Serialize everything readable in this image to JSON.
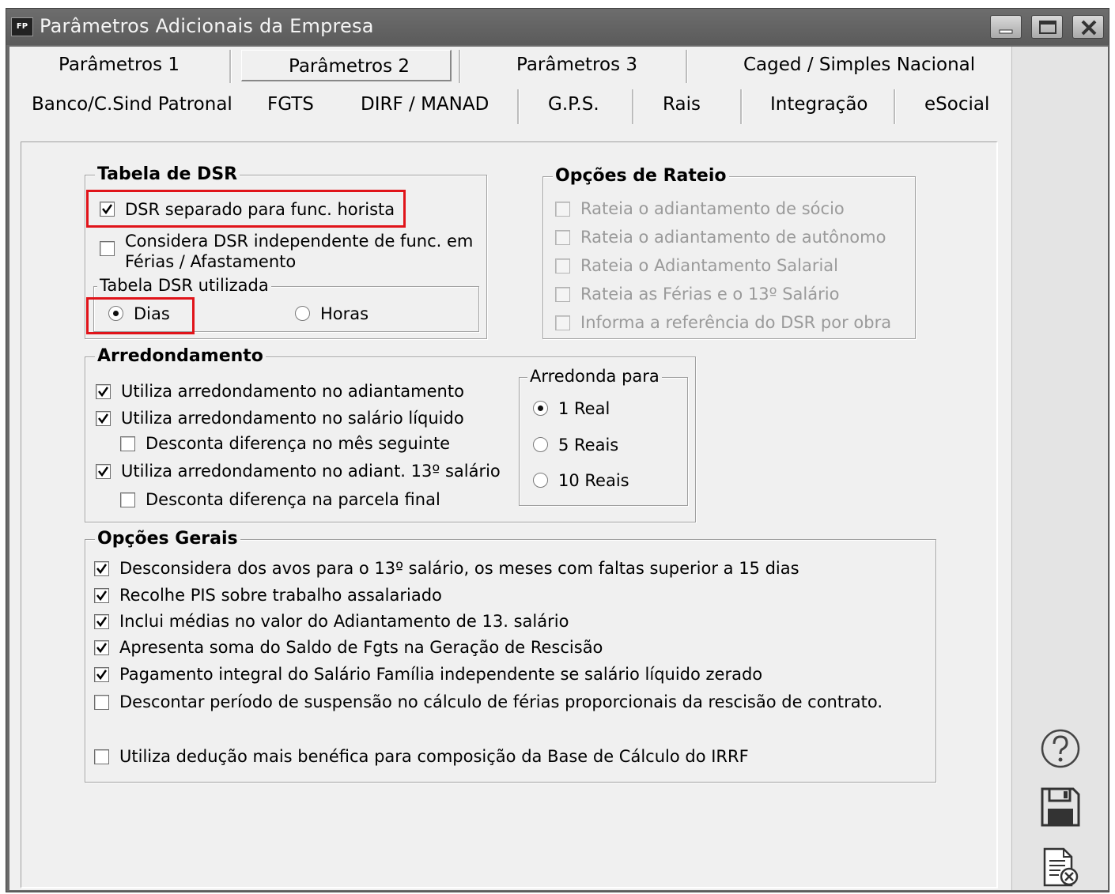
{
  "window": {
    "title": "Parâmetros Adicionais da Empresa",
    "icon_label": "FP"
  },
  "tabs_row1": [
    {
      "label": "Parâmetros 1"
    },
    {
      "label": "Parâmetros 2",
      "active": true
    },
    {
      "label": "Parâmetros 3"
    },
    {
      "label": "Caged / Simples Nacional"
    }
  ],
  "tabs_row2": [
    {
      "label": "Banco/C.Sind Patronal"
    },
    {
      "label": "FGTS"
    },
    {
      "label": "DIRF / MANAD"
    },
    {
      "label": "G.P.S."
    },
    {
      "label": "Rais"
    },
    {
      "label": "Integração"
    },
    {
      "label": "eSocial"
    }
  ],
  "dsr": {
    "title": "Tabela de DSR",
    "separado": {
      "label": "DSR separado para func. horista",
      "checked": true
    },
    "independente": {
      "label_line1": "Considera DSR independente de func. em",
      "label_line2": "Férias / Afastamento",
      "checked": false
    },
    "utilizada": {
      "title": "Tabela DSR utilizada",
      "options": [
        {
          "label": "Dias",
          "selected": true
        },
        {
          "label": "Horas",
          "selected": false
        }
      ]
    }
  },
  "rateio": {
    "title": "Opções de Rateio",
    "items": [
      {
        "label": "Rateia o adiantamento de sócio",
        "checked": false
      },
      {
        "label": "Rateia o adiantamento de autônomo",
        "checked": false
      },
      {
        "label": "Rateia o Adiantamento Salarial",
        "checked": false
      },
      {
        "label": "Rateia as Férias e o 13º Salário",
        "checked": false
      },
      {
        "label": "Informa a referência do DSR por obra",
        "checked": false
      }
    ]
  },
  "arredondamento": {
    "title": "Arredondamento",
    "items": [
      {
        "label": "Utiliza arredondamento no adiantamento",
        "checked": true
      },
      {
        "label": "Utiliza arredondamento no salário líquido",
        "checked": true
      },
      {
        "label": "Desconta diferença no mês seguinte",
        "checked": false
      },
      {
        "label": "Utiliza arredondamento no adiant. 13º salário",
        "checked": true
      },
      {
        "label": "Desconta diferença na parcela final",
        "checked": false
      }
    ],
    "para": {
      "title": "Arredonda para",
      "options": [
        {
          "label": "1 Real",
          "selected": true
        },
        {
          "label": "5 Reais",
          "selected": false
        },
        {
          "label": "10 Reais",
          "selected": false
        }
      ]
    }
  },
  "gerais": {
    "title": "Opções Gerais",
    "items": [
      {
        "label": "Desconsidera dos avos para o 13º salário, os meses com faltas superior a 15 dias",
        "checked": true
      },
      {
        "label": "Recolhe PIS sobre trabalho assalariado",
        "checked": true
      },
      {
        "label": "Inclui médias no valor do Adiantamento de 13. salário",
        "checked": true
      },
      {
        "label": "Apresenta soma do Saldo de Fgts na Geração de Rescisão",
        "checked": true
      },
      {
        "label": "Pagamento integral do Salário Família independente se salário líquido zerado",
        "checked": true
      },
      {
        "label": "Descontar período de suspensão no cálculo de férias proporcionais da rescisão de contrato.",
        "checked": false
      },
      {
        "label": "Utiliza dedução mais benéfica para composição da Base de Cálculo do IRRF",
        "checked": false
      }
    ]
  },
  "side_buttons": [
    {
      "icon": "help-icon"
    },
    {
      "icon": "save-icon"
    },
    {
      "icon": "cancel-document-icon"
    }
  ],
  "colors": {
    "titlebar": "#5f5f5f",
    "highlight": "#e0141a",
    "panel": "#f0f0f0"
  }
}
